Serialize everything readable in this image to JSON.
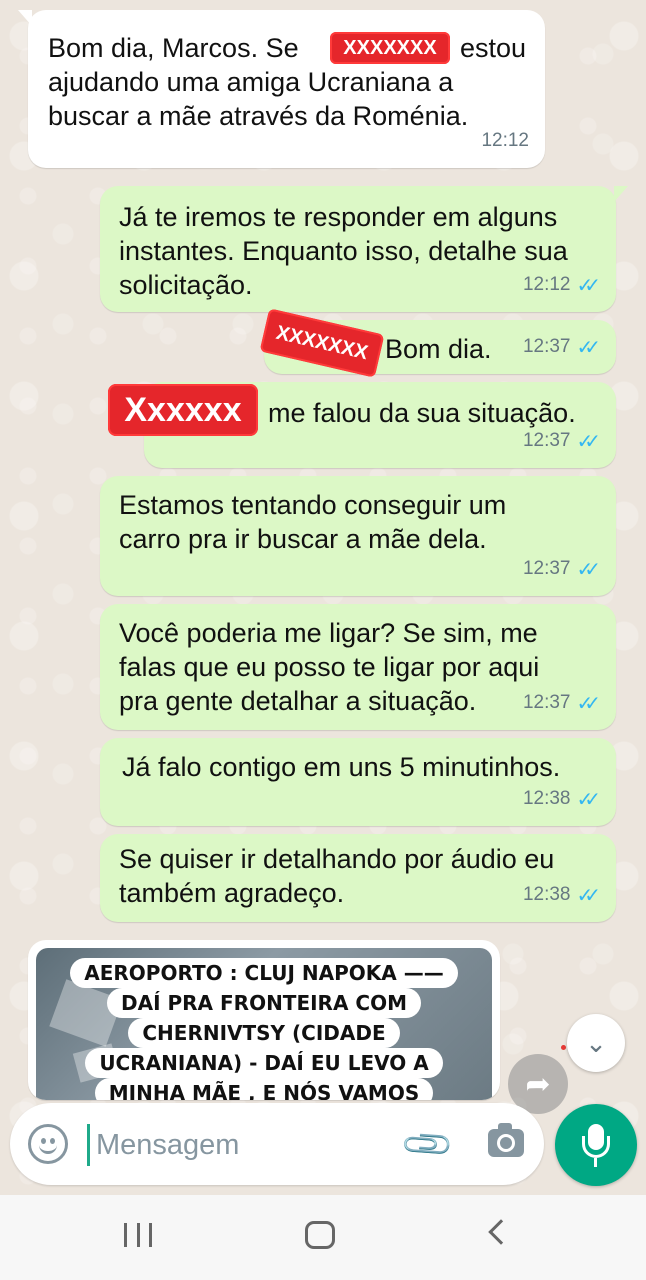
{
  "messages": [
    {
      "id": "m1",
      "direction": "incoming",
      "lines": [
        "Bom dia, Marcos. Se",
        "ajudando uma amiga Ucraniana a",
        "buscar a mãe através da Roménia."
      ],
      "after_redaction": "estou",
      "redaction": "XXXXXXX",
      "time": "12:12"
    },
    {
      "id": "m2",
      "direction": "outgoing",
      "lines": [
        "Já te iremos te responder em alguns",
        "instantes. Enquanto isso, detalhe sua",
        "solicitação."
      ],
      "time": "12:12",
      "status": "read"
    },
    {
      "id": "m3",
      "direction": "outgoing",
      "text": "Bom dia.",
      "redaction": "XXXXXXX",
      "time": "12:37",
      "status": "read"
    },
    {
      "id": "m4",
      "direction": "outgoing",
      "text": "me falou da sua situação.",
      "redaction": "Xxxxxx",
      "time": "12:37",
      "status": "read"
    },
    {
      "id": "m5",
      "direction": "outgoing",
      "lines": [
        "Estamos tentando conseguir um",
        "carro pra ir buscar a mãe dela."
      ],
      "time": "12:37",
      "status": "read"
    },
    {
      "id": "m6",
      "direction": "outgoing",
      "lines": [
        "Você poderia me ligar? Se sim, me",
        "falas que eu posso te ligar por aqui",
        "pra gente detalhar a situação."
      ],
      "time": "12:37",
      "status": "read"
    },
    {
      "id": "m7",
      "direction": "outgoing",
      "text": "Já falo contigo em uns 5 minutinhos.",
      "time": "12:38",
      "status": "read"
    },
    {
      "id": "m8",
      "direction": "outgoing",
      "lines": [
        "Se quiser ir detalhando por áudio eu",
        "também agradeço."
      ],
      "time": "12:38",
      "status": "read"
    }
  ],
  "image_message": {
    "direction": "incoming",
    "caption_lines": [
      "AEROPORTO : CLUJ NAPOKA ——",
      "DAÍ PRA FRONTEIRA COM",
      "CHERNIVTSY (CIDADE",
      "UCRANIANA) - DAÍ EU LEVO A",
      "MINHA MÃE , E NÓS VAMOS"
    ]
  },
  "read_ticks": "✓✓",
  "composer": {
    "placeholder": "Mensagem",
    "icons": [
      "emoji-icon",
      "attach-icon",
      "camera-icon"
    ]
  },
  "buttons": {
    "scroll_down_icon": "⌄",
    "forward_icon": "➦"
  },
  "colors": {
    "incoming_bubble": "#ffffff",
    "outgoing_bubble": "#dcf8c6",
    "read_ticks": "#34b7f1",
    "mic_button": "#00a884",
    "redaction": "#e5262b"
  }
}
